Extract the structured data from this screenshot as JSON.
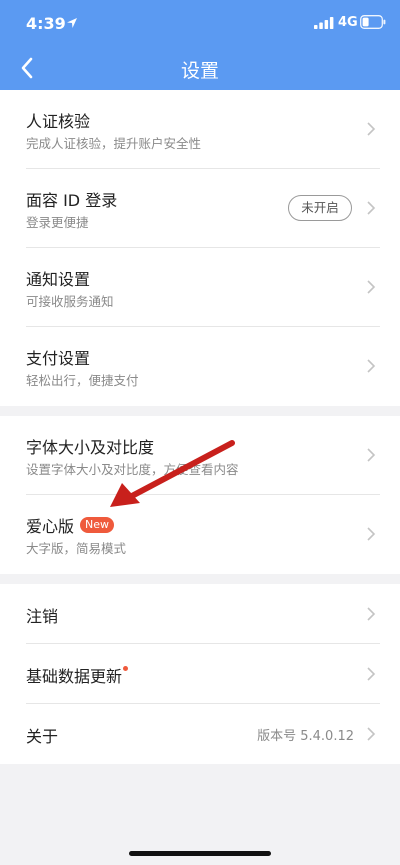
{
  "status_bar": {
    "time": "4:39",
    "network": "4G",
    "icons": [
      "location-icon",
      "signal-icon",
      "battery-icon"
    ]
  },
  "nav": {
    "title": "设置",
    "back_icon": "chevron-left-icon"
  },
  "groups": [
    {
      "rows": [
        {
          "title": "人证核验",
          "subtitle": "完成人证核验，提升账户安全性"
        },
        {
          "title": "面容 ID 登录",
          "subtitle": "登录更便捷",
          "toggle_label": "未开启"
        },
        {
          "title": "通知设置",
          "subtitle": "可接收服务通知"
        },
        {
          "title": "支付设置",
          "subtitle": "轻松出行，便捷支付"
        }
      ]
    },
    {
      "rows": [
        {
          "title": "字体大小及对比度",
          "subtitle": "设置字体大小及对比度，方便查看内容"
        },
        {
          "title": "爱心版",
          "badge": "New",
          "subtitle": "大字版，简易模式"
        }
      ]
    },
    {
      "rows": [
        {
          "title": "注销"
        },
        {
          "title": "基础数据更新"
        },
        {
          "title": "关于",
          "value": "版本号 5.4.0.12"
        }
      ]
    }
  ],
  "colors": {
    "header": "#5b9af2",
    "badge": "#ef5a3c",
    "annotation_arrow": "#c8201c"
  }
}
